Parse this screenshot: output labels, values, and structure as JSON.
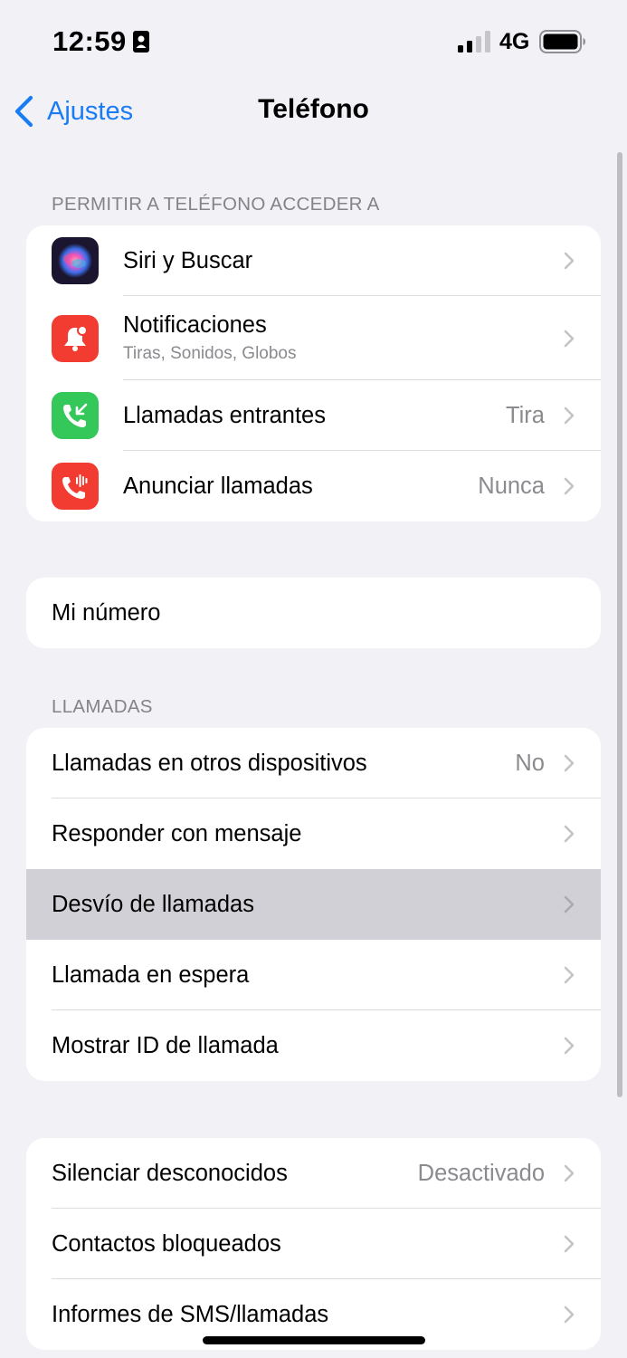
{
  "status_bar": {
    "time": "12:59",
    "network": "4G",
    "icons": [
      "person-badge-icon",
      "cellular-signal-icon",
      "battery-icon"
    ]
  },
  "nav": {
    "back_label": "Ajustes",
    "title": "Teléfono"
  },
  "sections": {
    "access": {
      "header": "PERMITIR A TELÉFONO ACCEDER A",
      "items": [
        {
          "label": "Siri y Buscar",
          "icon": "siri-icon"
        },
        {
          "label": "Notificaciones",
          "sublabel": "Tiras, Sonidos, Globos",
          "icon": "notifications-icon",
          "icon_color": "#f23c32"
        },
        {
          "label": "Llamadas entrantes",
          "value": "Tira",
          "icon": "incoming-call-icon",
          "icon_color": "#34c759"
        },
        {
          "label": "Anunciar llamadas",
          "value": "Nunca",
          "icon": "announce-calls-icon",
          "icon_color": "#f23c32"
        }
      ]
    },
    "number": {
      "items": [
        {
          "label": "Mi número"
        }
      ]
    },
    "calls": {
      "header": "LLAMADAS",
      "items": [
        {
          "label": "Llamadas en otros dispositivos",
          "value": "No"
        },
        {
          "label": "Responder con mensaje"
        },
        {
          "label": "Desvío de llamadas",
          "highlighted": true
        },
        {
          "label": "Llamada en espera"
        },
        {
          "label": "Mostrar ID de llamada"
        }
      ]
    },
    "blocking": {
      "items": [
        {
          "label": "Silenciar desconocidos",
          "value": "Desactivado"
        },
        {
          "label": "Contactos bloqueados"
        },
        {
          "label": "Informes de SMS/llamadas"
        }
      ]
    }
  },
  "colors": {
    "accent": "#1a7cf3",
    "background": "#f2f1f6",
    "highlight": "#d1d0d6"
  }
}
